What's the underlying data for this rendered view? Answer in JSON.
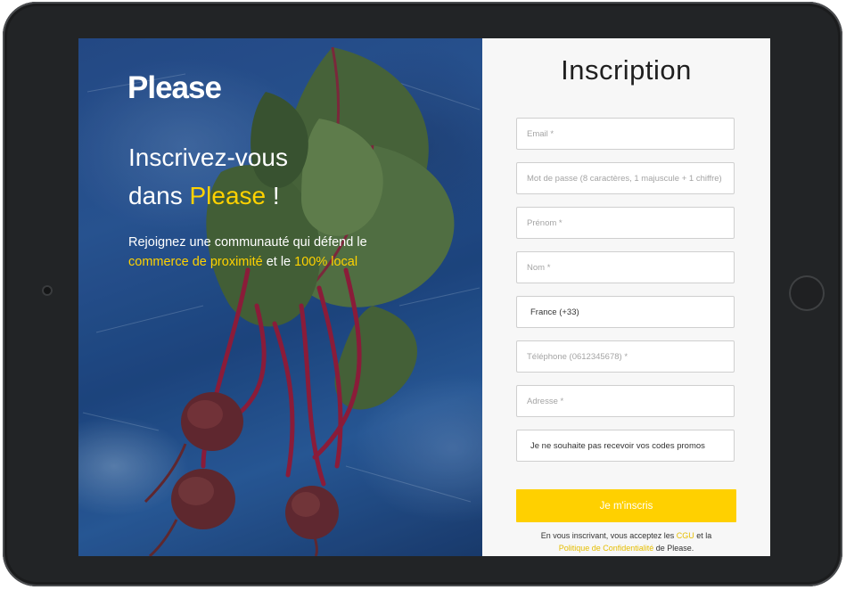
{
  "hero": {
    "logo": "Please",
    "headline_part1": "Inscrivez-vous",
    "headline_part2": "dans ",
    "headline_highlight": "Please",
    "headline_end": " !",
    "subtext_part1": "Rejoignez une communauté qui défend le",
    "subtext_highlight1": "commerce de proximité",
    "subtext_mid": " et le ",
    "subtext_highlight2": "100% local"
  },
  "form": {
    "title": "Inscription",
    "email_placeholder": "Email *",
    "password_placeholder": "Mot de passe (8 caractères, 1 majuscule + 1 chiffre)",
    "firstname_placeholder": "Prénom *",
    "lastname_placeholder": "Nom *",
    "country_selected": "France (+33)",
    "phone_placeholder": "Téléphone (0612345678) *",
    "address_placeholder": "Adresse *",
    "promo_optout_label": "Je ne souhaite pas recevoir vos codes promos",
    "submit_label": "Je m'inscris"
  },
  "legal": {
    "prefix": "En vous inscrivant, vous acceptez les ",
    "cgu_link": "CGU",
    "middle": " et la",
    "privacy_link": "Politique de Confidentialité",
    "suffix": " de Please."
  },
  "colors": {
    "accent": "#ffd000",
    "tablet_frame": "#222426",
    "hero_blue": "#2c5a9b"
  },
  "icons": [
    "camera-icon",
    "home-button-icon"
  ]
}
